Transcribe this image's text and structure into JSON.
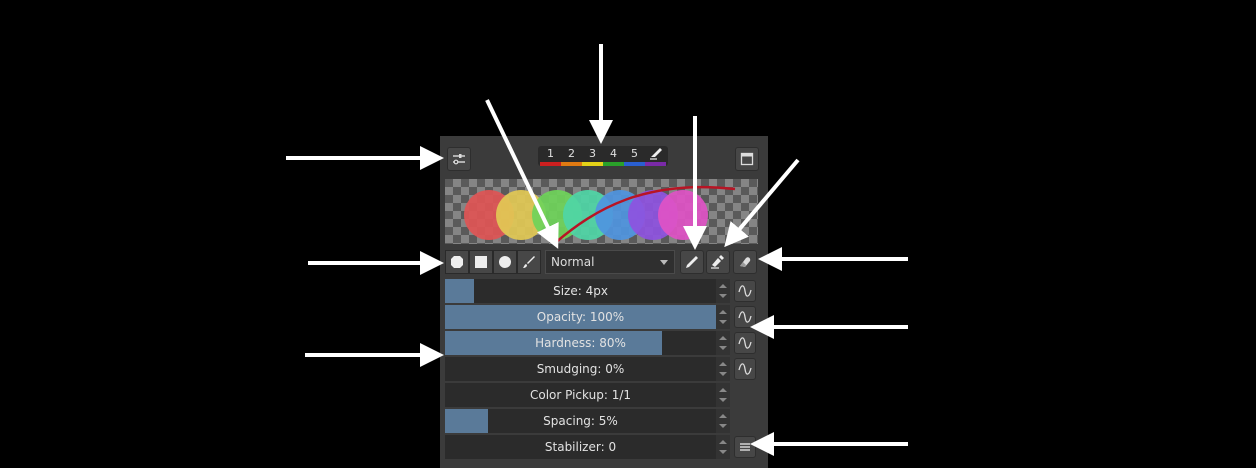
{
  "toolbar": {
    "settings_icon": "sliders-icon",
    "window_icon": "detach-window-icon",
    "slots": [
      {
        "label": "1",
        "color": "#cc1f1f"
      },
      {
        "label": "2",
        "color": "#e07a12"
      },
      {
        "label": "3",
        "color": "#e3d218"
      },
      {
        "label": "4",
        "color": "#2aa12a"
      },
      {
        "label": "5",
        "color": "#2a5fd0"
      }
    ],
    "eraser_slot": {
      "icon": "eraser-icon",
      "color": "#7a2aa8"
    }
  },
  "preview": {
    "circle_colors": [
      "#e05555",
      "#e2c955",
      "#6fd45a",
      "#4fd6a6",
      "#4f95e0",
      "#8e52e0",
      "#e052c6"
    ],
    "stroke_color": "#b81424"
  },
  "tips": [
    "round-tip-icon",
    "square-tip-icon",
    "circle-tip-icon",
    "brush-tip-icon"
  ],
  "blend_mode": {
    "value": "Normal"
  },
  "mode_buttons": [
    "pen-icon",
    "eraser-pen-icon",
    "eraser-icon"
  ],
  "sliders": [
    {
      "label": "Size: 4px",
      "fill": 0.1,
      "curve": true
    },
    {
      "label": "Opacity: 100%",
      "fill": 1.0,
      "curve": true
    },
    {
      "label": "Hardness: 80%",
      "fill": 0.8,
      "curve": true
    },
    {
      "label": "Smudging: 0%",
      "fill": 0.0,
      "curve": true
    },
    {
      "label": "Color Pickup: 1/1",
      "fill": 0.0,
      "curve": false
    },
    {
      "label": "Spacing: 5%",
      "fill": 0.15,
      "curve": false
    },
    {
      "label": "Stabilizer: 0",
      "fill": 0.0,
      "curve": false
    }
  ],
  "stabilizer_menu_icon": "hamburger-menu-icon"
}
